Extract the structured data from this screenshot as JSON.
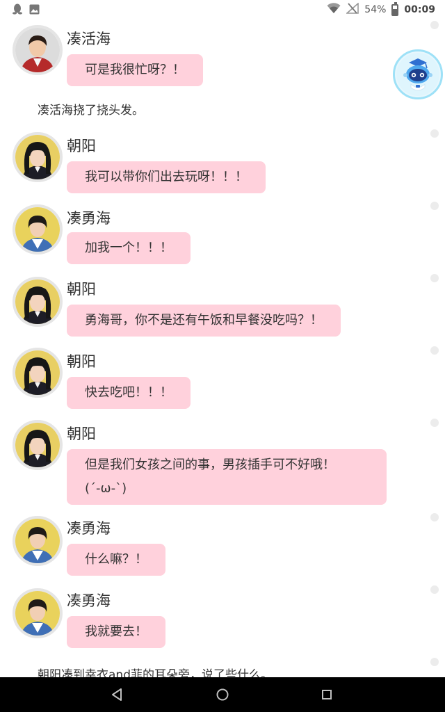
{
  "status_bar": {
    "battery": "54%",
    "time": "00:09",
    "left_icons": [
      "qq-icon",
      "image-icon"
    ],
    "right_icons": [
      "wifi-icon",
      "no-signal-icon",
      "battery-icon"
    ]
  },
  "chat": {
    "items": [
      {
        "type": "message",
        "name": "凑活海",
        "text": "可是我很忙呀？！",
        "avatar": "male-adult"
      },
      {
        "type": "narration",
        "text": "凑活海挠了挠头发。"
      },
      {
        "type": "message",
        "name": "朝阳",
        "text": "我可以带你们出去玩呀！！！",
        "avatar": "girl"
      },
      {
        "type": "message",
        "name": "凑勇海",
        "text": "加我一个！！！",
        "avatar": "boy"
      },
      {
        "type": "message",
        "name": "朝阳",
        "text": "勇海哥，你不是还有午饭和早餐没吃吗？！",
        "avatar": "girl"
      },
      {
        "type": "message",
        "name": "朝阳",
        "text": "快去吃吧！！！",
        "avatar": "girl"
      },
      {
        "type": "message",
        "name": "朝阳",
        "text_lines": [
          "但是我们女孩之间的事，男孩插手可不好哦！",
          "(´-ω-`)"
        ],
        "avatar": "girl"
      },
      {
        "type": "message",
        "name": "凑勇海",
        "text": "什么嘛？！",
        "avatar": "boy"
      },
      {
        "type": "message",
        "name": "凑勇海",
        "text": "我就要去！",
        "avatar": "boy"
      },
      {
        "type": "narration",
        "text": "朝阳凑到幸衣and菲的耳朵旁，说了些什么。"
      }
    ]
  },
  "floating_assistant": {
    "icon": "robot-assistant-icon"
  },
  "nav_bar": {
    "buttons": [
      "back-icon",
      "home-icon",
      "recents-icon"
    ]
  },
  "colors": {
    "bubble": "#ffd1dc",
    "nav_bar": "#000000",
    "robot_ring": "#9ee1f7"
  }
}
